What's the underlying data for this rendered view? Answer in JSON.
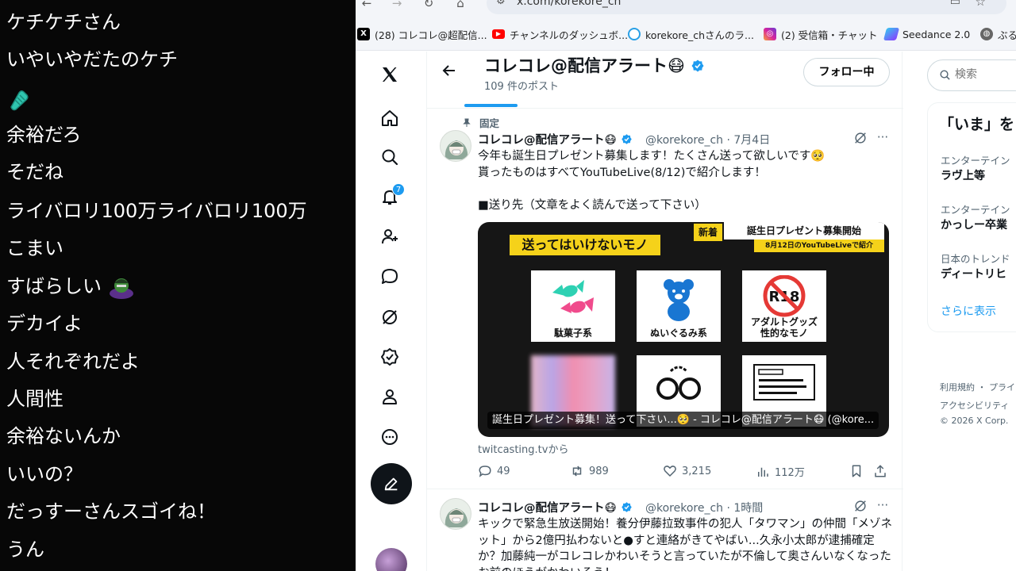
{
  "chat": {
    "messages": [
      {
        "text": "ケチケチさん"
      },
      {
        "text": "いやいやだたのケチ"
      },
      {
        "text": "",
        "emoji": "hand-emoji"
      },
      {
        "text": "余裕だろ"
      },
      {
        "text": "そだね"
      },
      {
        "text": "ライバロリ100万ライバロリ100万"
      },
      {
        "text": "こまい"
      },
      {
        "text": "すばらしい",
        "emoji": "character-emoji"
      },
      {
        "text": "デカイよ"
      },
      {
        "text": "人それぞれだよ"
      },
      {
        "text": "人間性"
      },
      {
        "text": "余裕ないんか"
      },
      {
        "text": "いいの？"
      },
      {
        "text": "だっすーさんスゴイね！"
      },
      {
        "text": "うん"
      }
    ]
  },
  "browser": {
    "url": "x.com/korekore_ch",
    "bookmarks": [
      {
        "label": "(28) コレコレ@超配信...",
        "icon": "x-icon",
        "color": "#000000"
      },
      {
        "label": "チャンネルのダッシュボ...",
        "icon": "youtube-icon",
        "color": "#ff0000"
      },
      {
        "label": "korekore_chさんのラ...",
        "icon": "twitcasting-icon",
        "color": "#2aa0e6"
      },
      {
        "label": "(2) 受信箱・チャット",
        "icon": "instagram-icon",
        "color": "#d6249f"
      },
      {
        "label": "Seedance 2.0",
        "icon": "seedance-icon",
        "color": "#6a5cff"
      },
      {
        "label": "ぶる",
        "icon": "globe-icon",
        "color": "#555555"
      }
    ]
  },
  "nav": {
    "notification_count": "7"
  },
  "profile": {
    "name": "コレコレ@配信アラート😷",
    "post_count": "109 件のポスト",
    "follow_label": "フォロー中"
  },
  "tweets": [
    {
      "pinned_label": "固定",
      "name": "コレコレ@配信アラート😷",
      "handle": "@korekore_ch · 7月4日",
      "body": "今年も誕生日プレゼント募集します！たくさん送って欲しいです🥺\n貰ったものはすべてYouTubeLive(8/12)で紹介します！\n\n■送り先（文章をよく読んで送って下さい）",
      "card": {
        "tag": "送ってはいけないモノ",
        "new_label": "新着",
        "title": "誕生日プレゼント募集開始",
        "date": "8月12日のYouTubeLiveで紹介",
        "tiles": [
          "駄菓子系",
          "ぬいぐるみ系",
          "アダルトグッズ\n性的なモノ",
          "",
          "",
          ""
        ],
        "r18_label": "R18",
        "caption": "誕生日プレゼント募集！送って下さい...🥺 - コレコレ@配信アラート😷 (@kore...",
        "source": "twitcasting.tvから"
      },
      "stats": {
        "replies": "49",
        "reposts": "989",
        "likes": "3,215",
        "views": "112万"
      }
    },
    {
      "name": "コレコレ@配信アラート😷",
      "handle": "@korekore_ch · 1時間",
      "body": "キックで緊急生放送開始！養分伊藤拉致事件の犯人「タワマン」の仲間「メゾネット」から2億円払わないと●すと連絡がきてやばい...久永小太郎が逮捕確定か？加藤純一がコレコレかわいそうと言っていたが不倫して奥さんいなくなったお前のほうがかわいそう！"
    }
  ],
  "sidebar": {
    "search_placeholder": "検索",
    "trends_title": "「いま」を",
    "trends": [
      {
        "category": "エンターテイン",
        "name": "ラヴ上等"
      },
      {
        "category": "エンターテイン",
        "name": "かっしー卒業"
      },
      {
        "category": "日本のトレンド",
        "name": "ディートリヒ"
      }
    ],
    "show_more": "さらに表示",
    "footer": [
      "利用規約 ・ プライ",
      "アクセシビリティ",
      "© 2026 X Corp."
    ]
  }
}
